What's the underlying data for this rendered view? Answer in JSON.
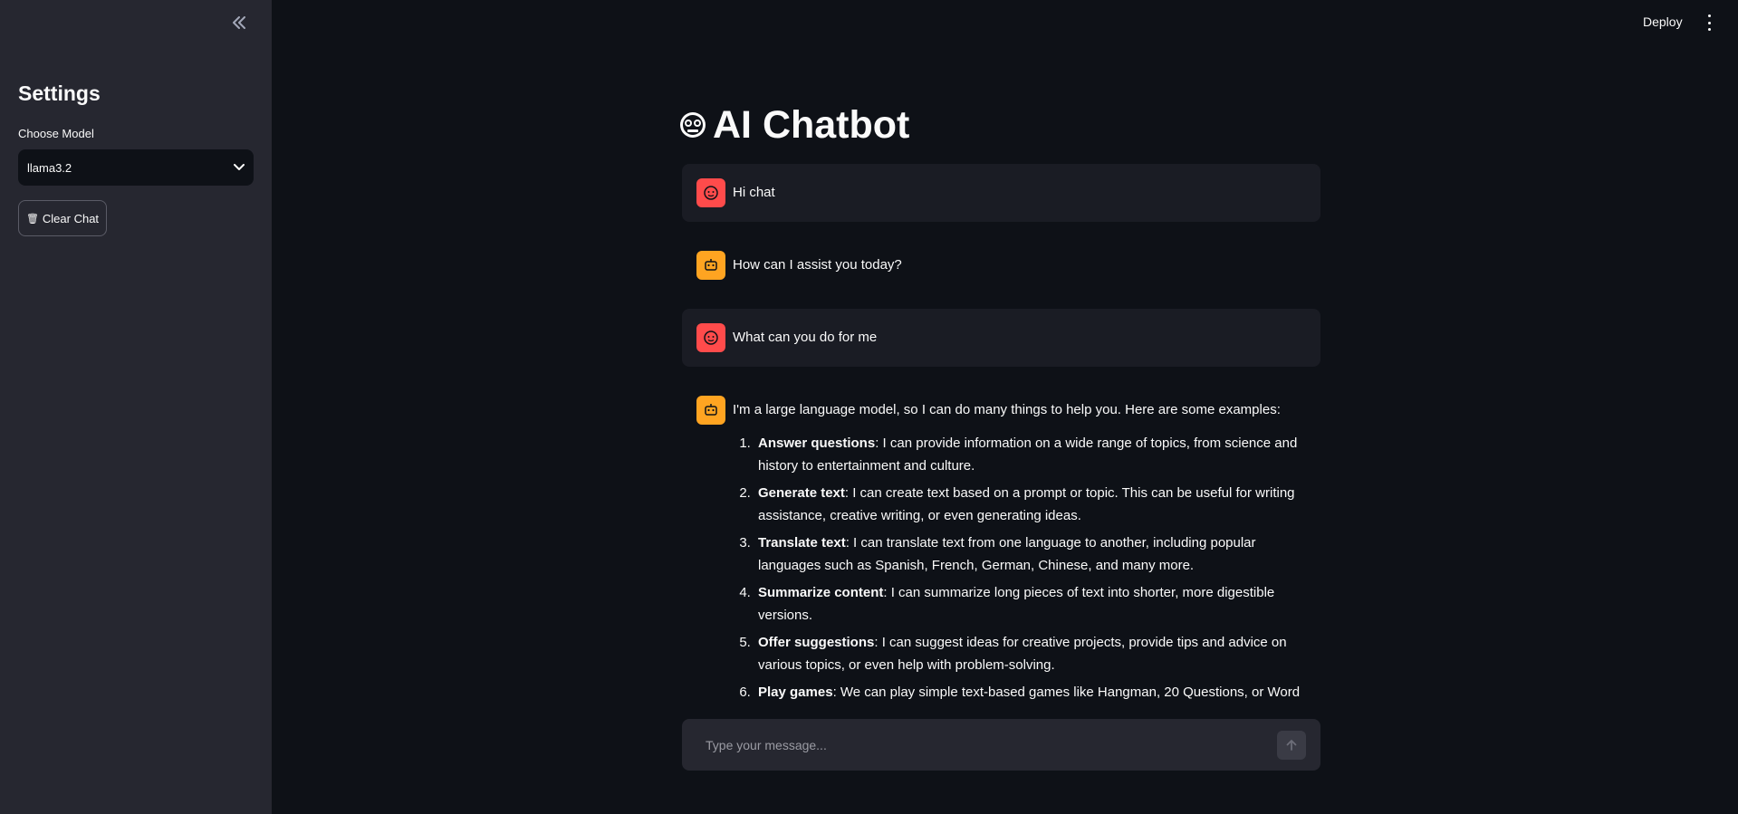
{
  "header": {
    "deploy_label": "Deploy"
  },
  "sidebar": {
    "title": "Settings",
    "model_label": "Choose Model",
    "model_selected": "llama3.2",
    "clear_button_label": "Clear Chat",
    "clear_button_icon": "🗑"
  },
  "main": {
    "title": "AI Chatbot",
    "title_icon": "robot-face-icon"
  },
  "messages": [
    {
      "role": "user",
      "text": "Hi chat"
    },
    {
      "role": "assistant",
      "text": "How can I assist you today?"
    },
    {
      "role": "user",
      "text": "What can you do for me"
    },
    {
      "role": "assistant",
      "intro": "I'm a large language model, so I can do many things to help you. Here are some examples:",
      "items": [
        {
          "title": "Answer questions",
          "text": ": I can provide information on a wide range of topics, from science and history to entertainment and culture."
        },
        {
          "title": "Generate text",
          "text": ": I can create text based on a prompt or topic. This can be useful for writing assistance, creative writing, or even generating ideas."
        },
        {
          "title": "Translate text",
          "text": ": I can translate text from one language to another, including popular languages such as Spanish, French, German, Chinese, and many more."
        },
        {
          "title": "Summarize content",
          "text": ": I can summarize long pieces of text into shorter, more digestible versions."
        },
        {
          "title": "Offer suggestions",
          "text": ": I can suggest ideas for creative projects, provide tips and advice on various topics, or even help with problem-solving."
        },
        {
          "title": "Play games",
          "text": ": We can play simple text-based games like Hangman, 20 Questions, or Word"
        }
      ]
    }
  ],
  "chat_input": {
    "placeholder": "Type your message..."
  },
  "colors": {
    "background": "#0e1117",
    "sidebar": "#262730",
    "user_avatar": "#ff4b4b",
    "bot_avatar": "#ffa421"
  }
}
